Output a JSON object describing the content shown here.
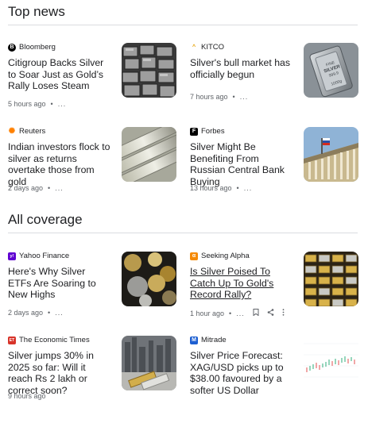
{
  "top_news": {
    "title": "Top news",
    "articles": [
      {
        "source": "Bloomberg",
        "headline": "Citigroup Backs Silver to Soar Just as Gold’s Rally Loses Steam",
        "time": "5 hours ago",
        "more": "..."
      },
      {
        "source": "KITCO",
        "headline": "Silver's bull market has officially begun",
        "time": "7 hours ago",
        "more": "..."
      },
      {
        "source": "Reuters",
        "headline": "Indian investors flock to silver as returns overtake those from gold",
        "time": "2 days ago",
        "more": "..."
      },
      {
        "source": "Forbes",
        "headline": "Silver Might Be Benefiting From Russian Central Bank Buying",
        "time": "13 hours ago",
        "more": "..."
      }
    ]
  },
  "all_coverage": {
    "title": "All coverage",
    "articles": [
      {
        "source": "Yahoo Finance",
        "headline": "Here's Why Silver ETFs Are Soaring to New Highs",
        "time": "2 days ago",
        "more": "..."
      },
      {
        "source": "Seeking Alpha",
        "headline": "Is Silver Poised To Catch Up To Gold's Record Rally?",
        "time": "1 hour ago",
        "more": "..."
      },
      {
        "source": "The Economic Times",
        "headline": "Silver jumps 30% in 2025 so far: Will it reach Rs 2 lakh or correct soon?",
        "time": "9 hours ago",
        "more": "..."
      },
      {
        "source": "Mitrade",
        "headline": "Silver Price Forecast: XAG/USD picks up to $38.00 favoured by a softer US Dollar",
        "time": "",
        "more": ""
      }
    ]
  },
  "thumb_text": {
    "kitco_bar": "FINE SILVER 999.9 NET WT 1000g"
  },
  "logos": {
    "bloomberg": "B",
    "kitco": "^",
    "reuters": "✺",
    "forbes": "F",
    "yahoo": "y!",
    "seeking_alpha": "α",
    "et": "ET",
    "mitrade": "M"
  }
}
